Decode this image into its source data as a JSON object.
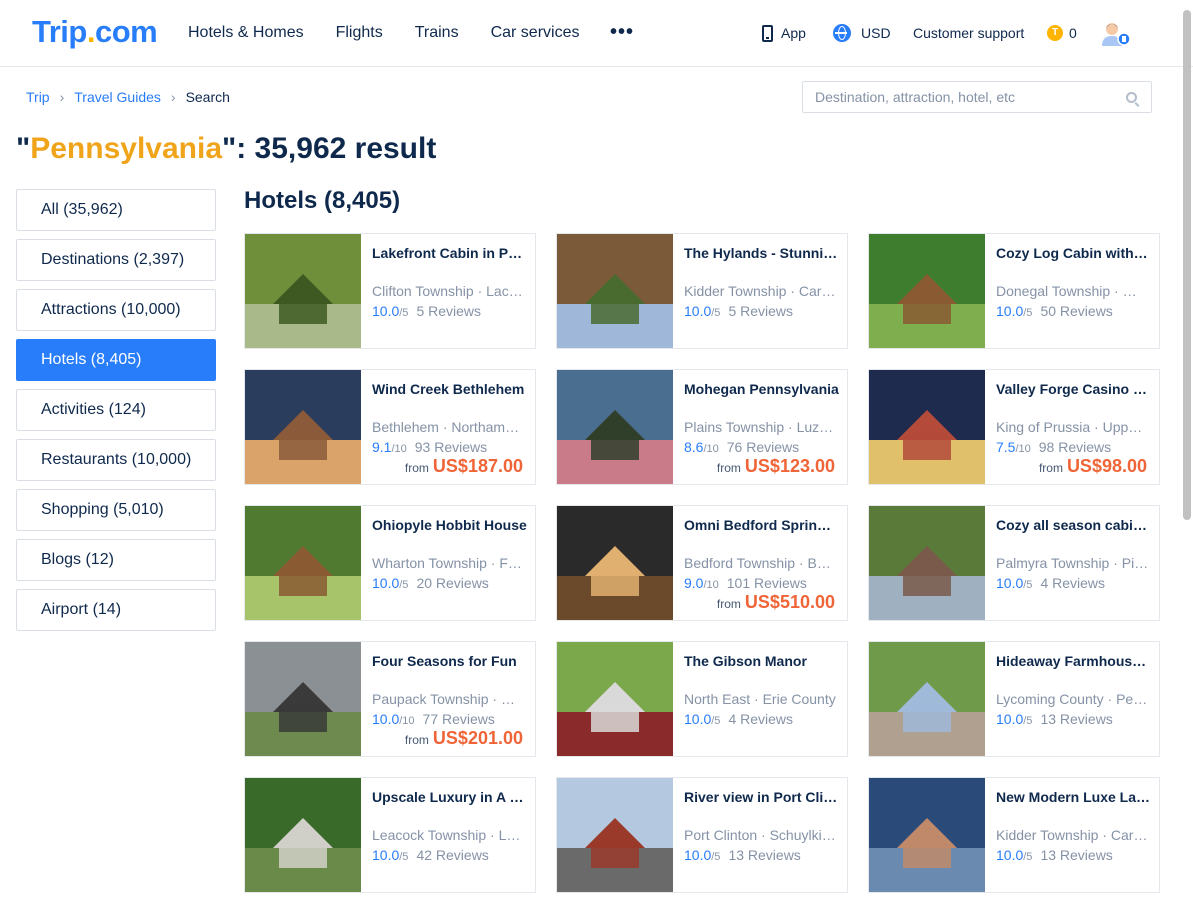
{
  "header": {
    "logo_main": "Trip",
    "logo_dot": ".",
    "logo_tail": "com",
    "nav": [
      "Hotels & Homes",
      "Flights",
      "Trains",
      "Car services"
    ],
    "more": "•••",
    "app_label": "App",
    "currency_label": "USD",
    "support_label": "Customer support",
    "coins": "0"
  },
  "breadcrumb": {
    "items": [
      "Trip",
      "Travel Guides"
    ],
    "current": "Search",
    "separator": "›"
  },
  "search": {
    "placeholder": "Destination, attraction, hotel, etc"
  },
  "result": {
    "quote_open": "\"",
    "keyword": "Pennsylvania",
    "suffix": "\": 35,962 result"
  },
  "sidebar": {
    "items": [
      "All (35,962)",
      "Destinations (2,397)",
      "Attractions (10,000)",
      "Hotels (8,405)",
      "Activities (124)",
      "Restaurants (10,000)",
      "Shopping (5,010)",
      "Blogs (12)",
      "Airport (14)"
    ],
    "active_index": 3
  },
  "hotels": {
    "title": "Hotels (8,405)",
    "cards": [
      {
        "name": "Lakefront Cabin in Pocono Lake",
        "location": "Clifton Township · Lackawanna County",
        "score": "10.0",
        "scale": "/5",
        "reviews": "5 Reviews",
        "price": "",
        "from": ""
      },
      {
        "name": "The Hylands - Stunning Lodge",
        "location": "Kidder Township · Carbon County",
        "score": "10.0",
        "scale": "/5",
        "reviews": "5 Reviews",
        "price": "",
        "from": ""
      },
      {
        "name": "Cozy Log Cabin with Fire Pit",
        "location": "Donegal Township · Westmoreland County",
        "score": "10.0",
        "scale": "/5",
        "reviews": "50 Reviews",
        "price": "",
        "from": ""
      },
      {
        "name": "Wind Creek Bethlehem",
        "location": "Bethlehem · Northampton County",
        "score": "9.1",
        "scale": "/10",
        "reviews": "93 Reviews",
        "price": "US$187.00",
        "from": "from"
      },
      {
        "name": "Mohegan Pennsylvania",
        "location": "Plains Township · Luzerne County",
        "score": "8.6",
        "scale": "/10",
        "reviews": "76 Reviews",
        "price": "US$123.00",
        "from": "from"
      },
      {
        "name": "Valley Forge Casino Resort",
        "location": "King of Prussia · Upper Merion Township",
        "score": "7.5",
        "scale": "/10",
        "reviews": "98 Reviews",
        "price": "US$98.00",
        "from": "from"
      },
      {
        "name": "Ohiopyle Hobbit House",
        "location": "Wharton Township · Fayette County",
        "score": "10.0",
        "scale": "/5",
        "reviews": "20 Reviews",
        "price": "",
        "from": ""
      },
      {
        "name": "Omni Bedford Springs Resort",
        "location": "Bedford Township · Bedford County",
        "score": "9.0",
        "scale": "/10",
        "reviews": "101 Reviews",
        "price": "US$510.00",
        "from": "from"
      },
      {
        "name": "Cozy all season cabin retreat",
        "location": "Palmyra Township · Pike County",
        "score": "10.0",
        "scale": "/5",
        "reviews": "4 Reviews",
        "price": "",
        "from": ""
      },
      {
        "name": "Four Seasons for Fun",
        "location": "Paupack Township · Wayne County",
        "score": "10.0",
        "scale": "/10",
        "reviews": "77 Reviews",
        "price": "US$201.00",
        "from": "from"
      },
      {
        "name": "The Gibson Manor",
        "location": "North East · Erie County",
        "score": "10.0",
        "scale": "/5",
        "reviews": "4 Reviews",
        "price": "",
        "from": ""
      },
      {
        "name": "Hideaway Farmhouse Retreat",
        "location": "Lycoming County · Pennsylvania",
        "score": "10.0",
        "scale": "/5",
        "reviews": "13 Reviews",
        "price": "",
        "from": ""
      },
      {
        "name": "Upscale Luxury in A Quiet Area",
        "location": "Leacock Township · Lancaster County",
        "score": "10.0",
        "scale": "/5",
        "reviews": "42 Reviews",
        "price": "",
        "from": ""
      },
      {
        "name": "River view in Port Clinton",
        "location": "Port Clinton · Schuylkill County",
        "score": "10.0",
        "scale": "/5",
        "reviews": "13 Reviews",
        "price": "",
        "from": ""
      },
      {
        "name": "New Modern Luxe Lake House",
        "location": "Kidder Township · Carbon County",
        "score": "10.0",
        "scale": "/5",
        "reviews": "13 Reviews",
        "price": "",
        "from": ""
      }
    ]
  },
  "colors": {
    "brand_blue": "#287dfa",
    "keyword_orange": "#f0a41a",
    "price_orange": "#f06537",
    "text_dark": "#0f294d",
    "text_gray": "#8592a6"
  }
}
